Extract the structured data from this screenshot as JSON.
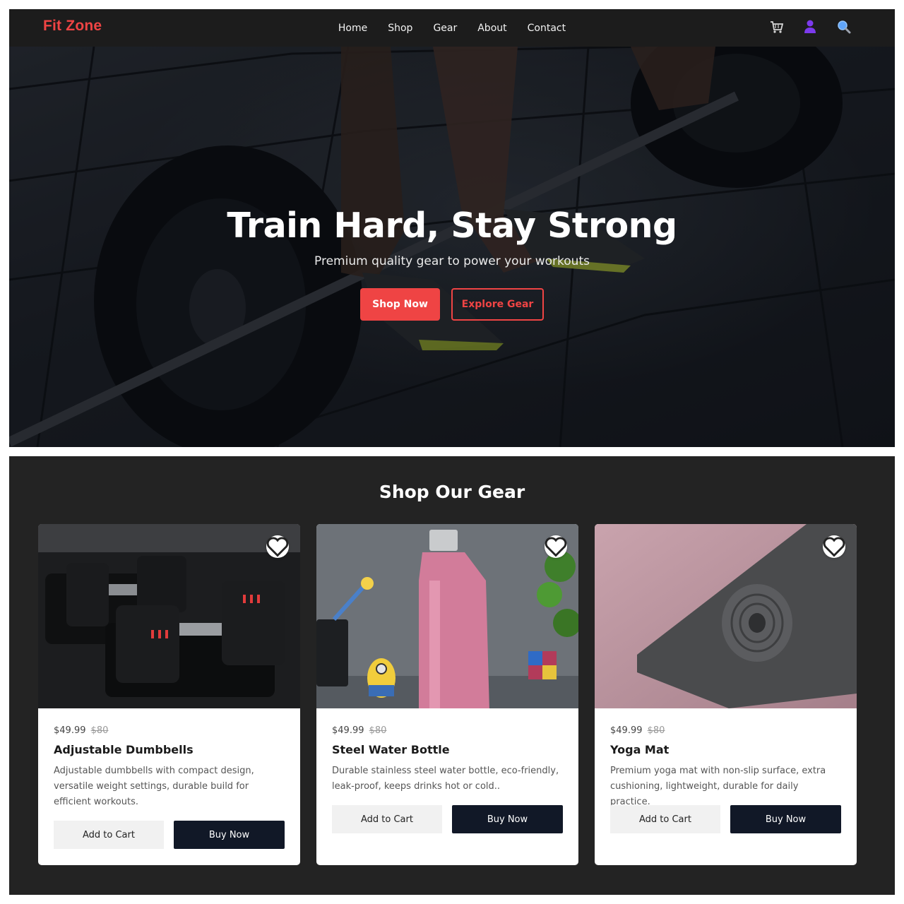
{
  "header": {
    "brand": "Fit Zone",
    "nav": [
      "Home",
      "Shop",
      "Gear",
      "About",
      "Contact"
    ],
    "icons": [
      "cart-icon",
      "user-icon",
      "search-icon"
    ],
    "brand_color": "#ef4444"
  },
  "hero": {
    "title": "Train Hard, Stay Strong",
    "subtitle": "Premium quality gear to power your workouts",
    "primary_cta": "Shop Now",
    "secondary_cta": "Explore Gear"
  },
  "products_section": {
    "title": "Shop Our Gear",
    "add_to_cart_label": "Add to Cart",
    "buy_now_label": "Buy Now",
    "products": [
      {
        "name": "Adjustable Dumbbells",
        "price": "$49.99",
        "old_price": "$80",
        "description": "Adjustable dumbbells with compact design, versatile weight settings, durable build for efficient workouts."
      },
      {
        "name": "Steel Water Bottle",
        "price": "$49.99",
        "old_price": "$80",
        "description": "Durable stainless steel water bottle, eco-friendly, leak-proof, keeps drinks hot or cold.."
      },
      {
        "name": "Yoga Mat",
        "price": "$49.99",
        "old_price": "$80",
        "description": "Premium yoga mat with non-slip surface, extra cushioning, lightweight, durable for daily practice."
      }
    ]
  },
  "colors": {
    "accent": "#ef4444",
    "dark_button": "#111827",
    "section_bg": "#232323",
    "nav_bg": "#1c1c1c"
  }
}
